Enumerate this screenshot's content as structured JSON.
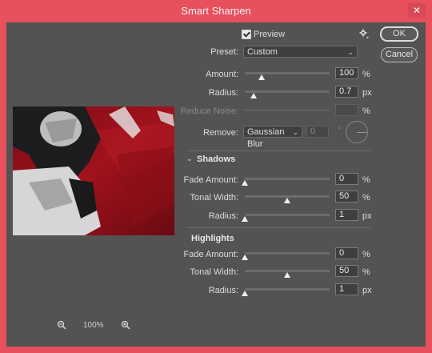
{
  "window": {
    "title": "Smart Sharpen",
    "close_label": "✕"
  },
  "buttons": {
    "ok": "OK",
    "cancel": "Cancel"
  },
  "preview": {
    "label": "Preview",
    "checked": true
  },
  "preset": {
    "label": "Preset:",
    "value": "Custom"
  },
  "sharpen": {
    "amount": {
      "label": "Amount:",
      "value": "100",
      "unit": "%",
      "level": 0.2
    },
    "radius": {
      "label": "Radius:",
      "value": "0.7",
      "unit": "px",
      "level": 0.1
    },
    "reduce_noise": {
      "label": "Reduce Noise:",
      "value": "",
      "unit": "%",
      "level": 0
    },
    "remove": {
      "label": "Remove:",
      "value": "Gaussian Blur",
      "angle": "0",
      "angle_unit": "°"
    }
  },
  "shadows": {
    "title": "Shadows",
    "fade_amount": {
      "label": "Fade Amount:",
      "value": "0",
      "unit": "%",
      "level": 0
    },
    "tonal_width": {
      "label": "Tonal Width:",
      "value": "50",
      "unit": "%",
      "level": 0.5
    },
    "radius": {
      "label": "Radius:",
      "value": "1",
      "unit": "px",
      "level": 0
    }
  },
  "highlights": {
    "title": "Highlights",
    "fade_amount": {
      "label": "Fade Amount:",
      "value": "0",
      "unit": "%",
      "level": 0
    },
    "tonal_width": {
      "label": "Tonal Width:",
      "value": "50",
      "unit": "%",
      "level": 0.5
    },
    "radius": {
      "label": "Radius:",
      "value": "1",
      "unit": "px",
      "level": 0
    }
  },
  "zoom": {
    "level": "100%"
  },
  "icons": {
    "zoom_out": "zoom-out-icon",
    "zoom_in": "zoom-in-icon",
    "gear": "gear-icon",
    "chevron": "chevron-down-icon"
  }
}
